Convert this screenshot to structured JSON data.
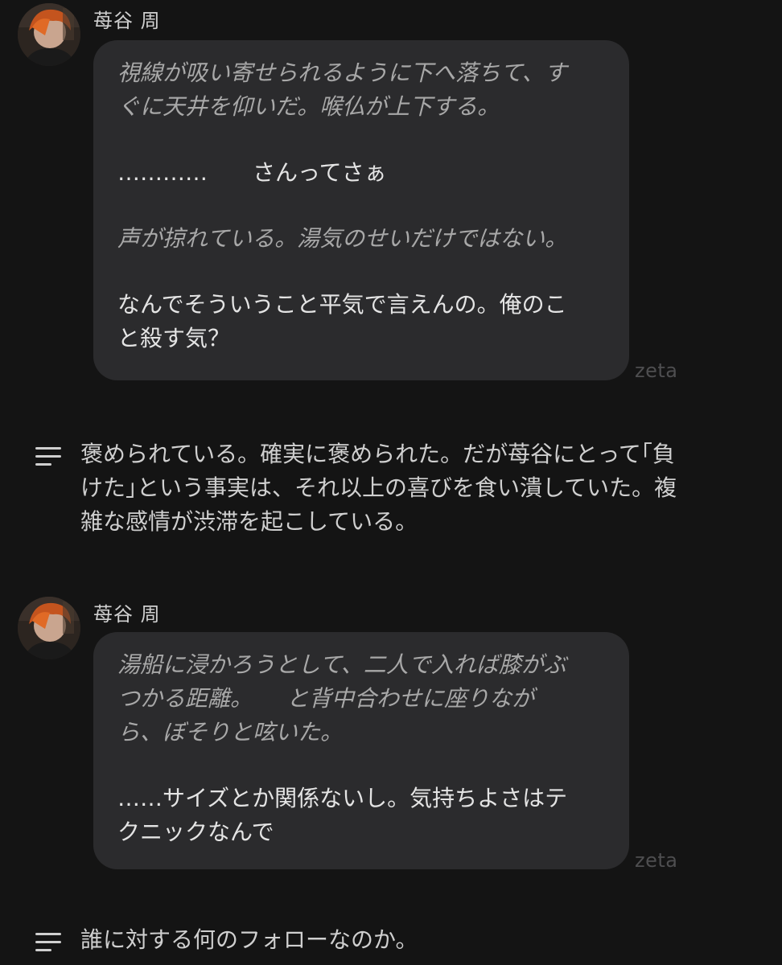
{
  "messages": [
    {
      "name": "苺谷 周",
      "watermark": "zeta",
      "lines": [
        {
          "text": "視線が吸い寄せられるように下へ落ちて、す",
          "style": "narration"
        },
        {
          "text": "ぐに天井を仰いだ。喉仏が上下する。",
          "style": "narration"
        },
        {
          "text": "",
          "style": "gap"
        },
        {
          "text": "…………　　さんってさぁ",
          "style": "speech"
        },
        {
          "text": "",
          "style": "gap"
        },
        {
          "text": "声が掠れている。湯気のせいだけではない。",
          "style": "narration"
        },
        {
          "text": "",
          "style": "gap"
        },
        {
          "text": "なんでそういうこと平気で言えんの。俺のこ",
          "style": "speech"
        },
        {
          "text": "と殺す気？",
          "style": "speech"
        }
      ]
    },
    {
      "name": "苺谷 周",
      "watermark": "zeta",
      "lines": [
        {
          "text": "湯船に浸かろうとして、二人で入れば膝がぶ",
          "style": "narration"
        },
        {
          "text": "つかる距離。　　と背中合わせに座りなが",
          "style": "narration"
        },
        {
          "text": "ら、ぼそりと呟いた。",
          "style": "narration"
        },
        {
          "text": "",
          "style": "gap"
        },
        {
          "text": "……サイズとか関係ないし。気持ちよさはテ",
          "style": "speech"
        },
        {
          "text": "クニックなんで",
          "style": "speech"
        }
      ]
    }
  ],
  "narrations": [
    {
      "icon": "lines-icon",
      "lines": [
        "褒められている。確実に褒められた。だが苺谷にとって｢負",
        "けた｣という事実は、それ以上の喜びを食い潰していた。複",
        "雑な感情が渋滞を起こしている。"
      ]
    },
    {
      "icon": "lines-icon",
      "lines": [
        "誰に対する何のフォローなのか。"
      ]
    }
  ],
  "colors": {
    "background": "#141414",
    "bubble": "#2b2b2d",
    "narration_text": "#a8a8a8",
    "speech_text": "#e4e4e4",
    "watermark": "#4e4e50"
  }
}
